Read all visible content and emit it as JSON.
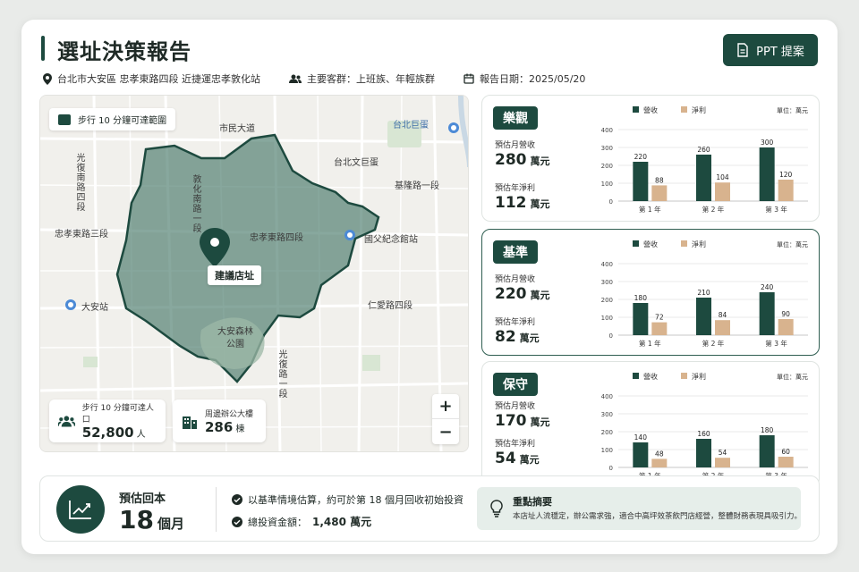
{
  "header": {
    "title": "選址決策報告",
    "ppt_button": "PPT 提案",
    "location": "台北市大安區  忠孝東路四段   近捷運忠孝敦化站",
    "customers": "主要客群：上班族、年輕族群",
    "report_date": "報告日期：2025/05/20"
  },
  "map": {
    "legend": "步行 10 分鐘可達範圍",
    "pin_label": "建議店址",
    "labels": {
      "shimin": "市民大道",
      "taipei_dome": "台北巨蛋",
      "dome_hidden": "台北文巨蛋",
      "guanghua": "光復南路四段",
      "dunhua": "敦化南路一段",
      "keelung": "基隆路一段",
      "zhongxiao3": "忠孝東路三段",
      "zhongxiao4": "忠孝東路四段",
      "sun_yat_sen": "國父紀念館站",
      "daan": "大安站",
      "renai": "仁愛路四段",
      "daan_park": "大安森林公園",
      "guangfu": "光復路一段"
    },
    "stat_population_label": "步行 10 分鐘可達人口",
    "stat_population_value": "52,800",
    "stat_population_unit": "人",
    "stat_office_label": "周邊辦公大樓",
    "stat_office_value": "286",
    "stat_office_unit": "棟",
    "zoom_in": "+",
    "zoom_out": "−"
  },
  "legend": {
    "revenue": "營收",
    "profit": "淨利",
    "unit": "單位：萬元"
  },
  "colors": {
    "revenue": "#1d4a3f",
    "profit": "#d8b38e",
    "brand": "#1d4a3f"
  },
  "scenarios": [
    {
      "name": "樂觀",
      "monthly_label": "預估月營收",
      "monthly_value": "280",
      "unit": "萬元",
      "profit_label": "預估年淨利",
      "profit_value": "112"
    },
    {
      "name": "基準",
      "monthly_label": "預估月營收",
      "monthly_value": "220",
      "unit": "萬元",
      "profit_label": "預估年淨利",
      "profit_value": "82"
    },
    {
      "name": "保守",
      "monthly_label": "預估月營收",
      "monthly_value": "170",
      "unit": "萬元",
      "profit_label": "預估年淨利",
      "profit_value": "54"
    }
  ],
  "chart_data": [
    {
      "type": "bar",
      "categories": [
        "第 1 年",
        "第 2 年",
        "第 3 年"
      ],
      "ylim": [
        0,
        400
      ],
      "yticks": [
        0,
        100,
        200,
        300,
        400
      ],
      "series": [
        {
          "name": "營收",
          "values": [
            220,
            260,
            300
          ]
        },
        {
          "name": "淨利",
          "values": [
            88,
            104,
            120
          ]
        }
      ]
    },
    {
      "type": "bar",
      "categories": [
        "第 1 年",
        "第 2 年",
        "第 3 年"
      ],
      "ylim": [
        0,
        400
      ],
      "yticks": [
        0,
        100,
        200,
        300,
        400
      ],
      "series": [
        {
          "name": "營收",
          "values": [
            180,
            210,
            240
          ]
        },
        {
          "name": "淨利",
          "values": [
            72,
            84,
            90
          ]
        }
      ]
    },
    {
      "type": "bar",
      "categories": [
        "第 1 年",
        "第 2 年",
        "第 3 年"
      ],
      "ylim": [
        0,
        400
      ],
      "yticks": [
        0,
        100,
        200,
        300,
        400
      ],
      "series": [
        {
          "name": "營收",
          "values": [
            140,
            160,
            180
          ]
        },
        {
          "name": "淨利",
          "values": [
            48,
            54,
            60
          ]
        }
      ]
    }
  ],
  "bottom": {
    "payback_label": "預估回本",
    "payback_value": "18",
    "payback_unit": "個月",
    "check1": "以基準情境估算，約可於第 18 個月回收初始投資",
    "check2_label": "總投資金額：",
    "check2_value": "1,480 萬元",
    "summary_title": "重點摘要",
    "summary_text": "本店址人流穩定，辦公需求強，適合中高坪效茶飲門店經營，整體財務表現具吸引力。"
  }
}
